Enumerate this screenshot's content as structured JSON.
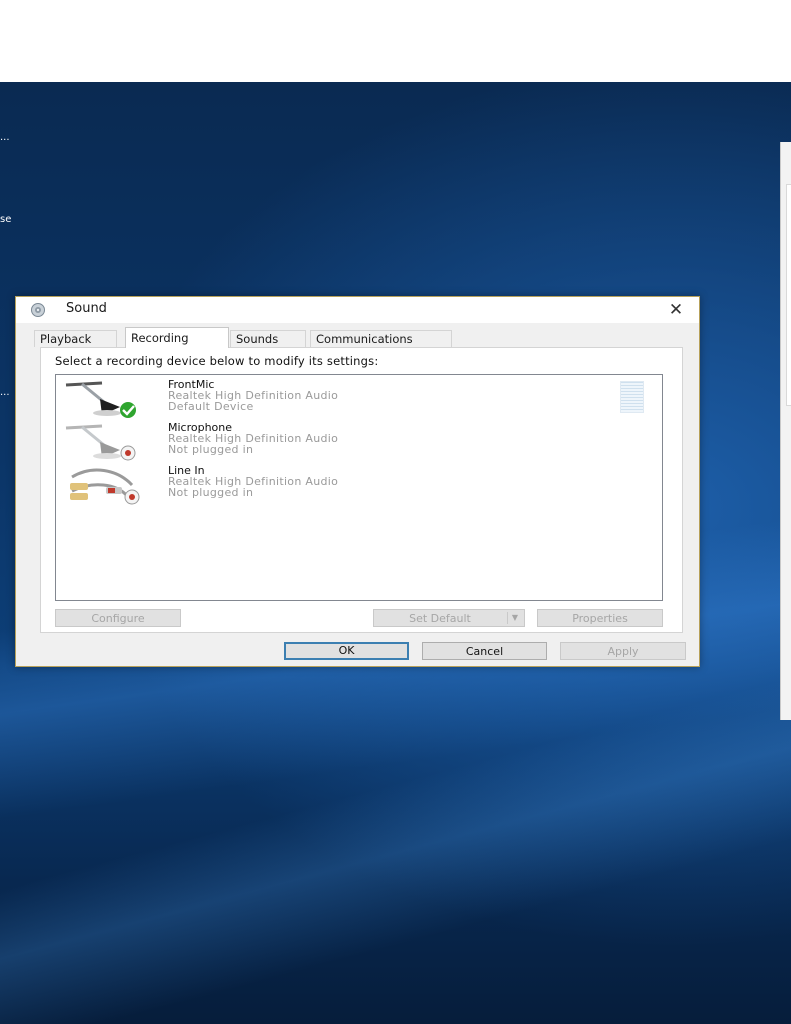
{
  "desktop": {
    "edge_labels": [
      "...",
      "se",
      "..."
    ]
  },
  "dialog": {
    "title": "Sound",
    "close_glyph": "✕",
    "icon": "speaker-icon",
    "tabs": [
      {
        "label": "Playback",
        "active": false
      },
      {
        "label": "Recording",
        "active": true
      },
      {
        "label": "Sounds",
        "active": false
      },
      {
        "label": "Communications",
        "active": false
      }
    ],
    "instruction": "Select a recording device below to modify its settings:",
    "devices": [
      {
        "name": "FrontMic",
        "driver": "Realtek High Definition Audio",
        "status": "Default Device",
        "icon": "microphone-default-icon"
      },
      {
        "name": "Microphone",
        "driver": "Realtek High Definition Audio",
        "status": "Not plugged in",
        "icon": "microphone-unplugged-icon"
      },
      {
        "name": "Line In",
        "driver": "Realtek High Definition Audio",
        "status": "Not plugged in",
        "icon": "line-in-unplugged-icon"
      }
    ],
    "buttons": {
      "configure": "Configure",
      "set_default": "Set Default",
      "set_default_arrow": "▼",
      "properties": "Properties",
      "ok": "OK",
      "cancel": "Cancel",
      "apply": "Apply"
    }
  },
  "colors": {
    "default_check": "#2fa52f",
    "unplugged_badge": "#c0392b",
    "focus_border": "#3c7fb1"
  }
}
